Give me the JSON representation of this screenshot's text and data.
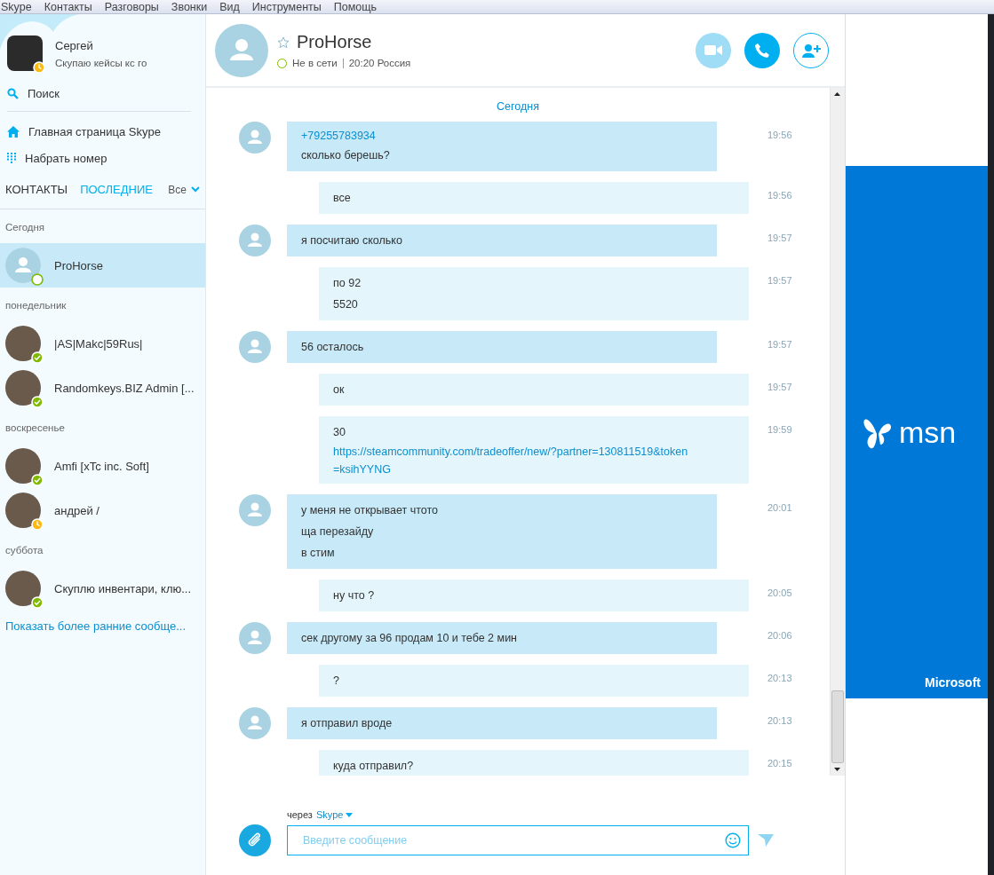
{
  "menu": [
    "Skype",
    "Контакты",
    "Разговоры",
    "Звонки",
    "Вид",
    "Инструменты",
    "Помощь"
  ],
  "profile": {
    "name": "Сергей",
    "mood": "Скупаю кейсы кс го",
    "kind": "away"
  },
  "sidebar": {
    "search": "Поиск",
    "links": [
      {
        "kind": "home",
        "label": "Главная страница Skype"
      },
      {
        "kind": "dialpad",
        "label": "Набрать номер"
      }
    ],
    "tabs": [
      {
        "label": "КОНТАКТЫ",
        "selected": false
      },
      {
        "label": "ПОСЛЕДНИЕ",
        "selected": true
      }
    ],
    "filter": "Все",
    "groups": [
      {
        "label": "Сегодня",
        "contacts": [
          {
            "name": "ProHorse",
            "kind": "offline",
            "selected": true,
            "photo": false
          }
        ]
      },
      {
        "label": "понедельник",
        "contacts": [
          {
            "name": "|AS|Makc|59Rus|",
            "kind": "online",
            "selected": false,
            "photo": true
          },
          {
            "name": "Randomkeys.BIZ Admin [...",
            "kind": "online",
            "selected": false,
            "photo": true
          }
        ]
      },
      {
        "label": "воскресенье",
        "contacts": [
          {
            "name": "Amfi [xTc inc. Soft]",
            "kind": "online",
            "selected": false,
            "photo": true
          },
          {
            "name": "андрей /",
            "kind": "away",
            "selected": false,
            "photo": true
          }
        ]
      },
      {
        "label": "суббота",
        "contacts": [
          {
            "name": "Скуплю инвентари, клю...",
            "kind": "online",
            "selected": false,
            "photo": true
          }
        ]
      }
    ],
    "more_link": "Показать более ранние сообще..."
  },
  "chat": {
    "name": "ProHorse",
    "kind": "offline",
    "status_text": "Не в сети",
    "local_time": "20:20 Россия",
    "day_label": "Сегодня",
    "messages": [
      {
        "kind": "incoming",
        "time": "19:56",
        "lines": [
          {
            "text": "+79255783934",
            "link": true
          },
          {
            "text": "сколько берешь?",
            "link": false
          }
        ]
      },
      {
        "kind": "outgoing",
        "time": "19:56",
        "lines": [
          {
            "text": "все",
            "link": false
          }
        ]
      },
      {
        "kind": "incoming",
        "time": "19:57",
        "lines": [
          {
            "text": "я посчитаю сколько",
            "link": false
          }
        ]
      },
      {
        "kind": "outgoing",
        "time": "19:57",
        "lines": [
          {
            "text": "по 92",
            "link": false
          },
          {
            "text": "5520",
            "link": false
          }
        ]
      },
      {
        "kind": "incoming",
        "time": "19:57",
        "lines": [
          {
            "text": "56 осталось",
            "link": false
          }
        ]
      },
      {
        "kind": "outgoing",
        "time": "19:57",
        "lines": [
          {
            "text": "ок",
            "link": false
          }
        ]
      },
      {
        "kind": "outgoing",
        "time": "19:59",
        "lines": [
          {
            "text": "30",
            "link": false
          },
          {
            "text": "https://steamcommunity.com/tradeoffer/new/?partner=130811519&token",
            "link": true
          },
          {
            "text": "=ksihYYNG",
            "link": true
          }
        ]
      },
      {
        "kind": "incoming",
        "time": "20:01",
        "lines": [
          {
            "text": "у меня не открывает чтото",
            "link": false
          },
          {
            "text": "ща перезайду",
            "link": false
          },
          {
            "text": "в стим",
            "link": false
          }
        ]
      },
      {
        "kind": "outgoing",
        "time": "20:05",
        "lines": [
          {
            "text": "ну что ?",
            "link": false
          }
        ]
      },
      {
        "kind": "incoming",
        "time": "20:06",
        "lines": [
          {
            "text": "сек другому за 96 продам 10 и тебе 2 мин",
            "link": false
          }
        ]
      },
      {
        "kind": "outgoing",
        "time": "20:13",
        "lines": [
          {
            "text": "?",
            "link": false
          }
        ]
      },
      {
        "kind": "incoming",
        "time": "20:13",
        "lines": [
          {
            "text": "я отправил вроде",
            "link": false
          }
        ]
      },
      {
        "kind": "outgoing",
        "time": "20:15",
        "lines": [
          {
            "text": "куда отправил?",
            "link": false
          }
        ]
      }
    ],
    "via_label": "через",
    "via_service": "Skype",
    "placeholder": "Введите сообщение"
  },
  "ad": {
    "logo_text": "msn",
    "brand": "Microsoft"
  }
}
